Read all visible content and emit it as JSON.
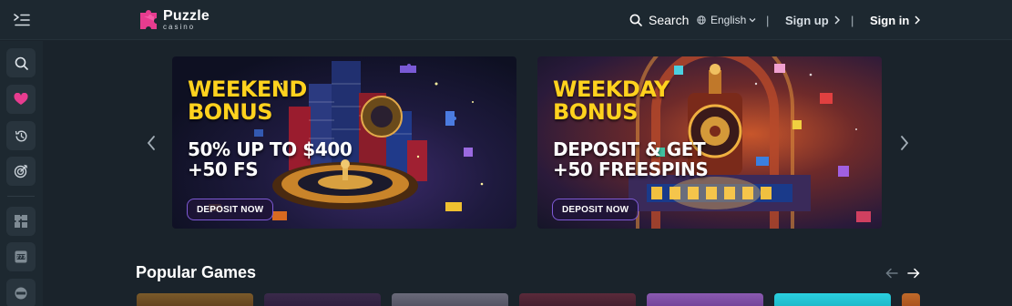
{
  "header": {
    "menu_icon": "menu-toggle-icon",
    "logo": {
      "brand": "Puzzle",
      "tagline": "casino"
    },
    "search_label": "Search",
    "language": "English",
    "separator": "|",
    "signup_label": "Sign up",
    "signin_label": "Sign in"
  },
  "sidebar": {
    "items": [
      {
        "icon": "search-icon"
      },
      {
        "icon": "heart-icon"
      },
      {
        "icon": "history-icon"
      },
      {
        "icon": "target-icon"
      },
      {
        "icon": "puzzle-grid-icon"
      },
      {
        "icon": "slot-machine-icon"
      },
      {
        "icon": "table-games-icon"
      }
    ]
  },
  "banners": [
    {
      "title_line1": "WEEKEND",
      "title_line2": "BONUS",
      "sub_line1": "50% UP TO $400",
      "sub_line2": "+50 FS",
      "button": "DEPOSIT NOW"
    },
    {
      "title_line1": "WEEKDAY",
      "title_line2": "BONUS",
      "sub_line1": "DEPOSIT & GET",
      "sub_line2": "+50 FREESPINS",
      "button": "DEPOSIT NOW"
    }
  ],
  "popular_games": {
    "title": "Popular Games"
  },
  "colors": {
    "background": "#1a232b",
    "header": "#1d2830",
    "accent_pink": "#e73c8f",
    "banner_title": "#ffd21e",
    "button_border": "#7e5ad6"
  }
}
